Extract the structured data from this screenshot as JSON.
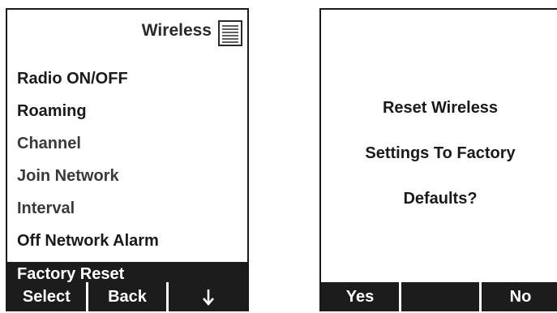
{
  "left_screen": {
    "header": {
      "title": "Wireless",
      "icon": "list-icon"
    },
    "menu": [
      {
        "label": "Radio ON/OFF"
      },
      {
        "label": "Roaming"
      },
      {
        "label": "Channel"
      },
      {
        "label": "Join Network"
      },
      {
        "label": "Interval"
      },
      {
        "label": "Off Network Alarm"
      },
      {
        "label": "Factory Reset"
      }
    ],
    "selected_index": 6,
    "softkeys": {
      "left": "Select",
      "middle": "Back",
      "right_icon": "arrow-down-icon"
    }
  },
  "right_screen": {
    "dialog": {
      "line1": "Reset Wireless",
      "line2": "Settings To Factory",
      "line3": "Defaults?"
    },
    "softkeys": {
      "left": "Yes",
      "middle": "",
      "right": "No"
    }
  },
  "colors": {
    "bar": "#1c1c1c",
    "text": "#1a1a1a",
    "background": "#ffffff"
  }
}
